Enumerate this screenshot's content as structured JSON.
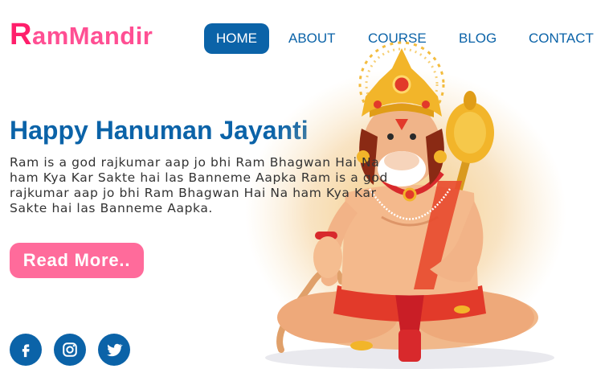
{
  "brand": {
    "first_letter": "R",
    "rest": "amMandir"
  },
  "nav": {
    "items": [
      {
        "label": "HOME",
        "active": true
      },
      {
        "label": "ABOUT",
        "active": false
      },
      {
        "label": "COURSE",
        "active": false
      },
      {
        "label": "BLOG",
        "active": false
      },
      {
        "label": "CONTACT",
        "active": false
      }
    ]
  },
  "hero": {
    "title": "Happy Hanuman Jayanti",
    "description": "Ram is a god rajkumar aap jo bhi Ram Bhagwan Hai Na ham Kya Kar Sakte hai las Banneme Aapka Ram is a god rajkumar aap jo bhi Ram Bhagwan Hai Na ham Kya Kar Sakte hai las Banneme Aapka.",
    "button_label": "Read More.."
  },
  "social": [
    {
      "icon": "facebook-icon"
    },
    {
      "icon": "instagram-icon"
    },
    {
      "icon": "twitter-icon"
    }
  ],
  "colors": {
    "primary": "#0b63a8",
    "brand_pink": "#ff2d78",
    "button_pink": "#ff6b9b",
    "text": "#333333"
  }
}
